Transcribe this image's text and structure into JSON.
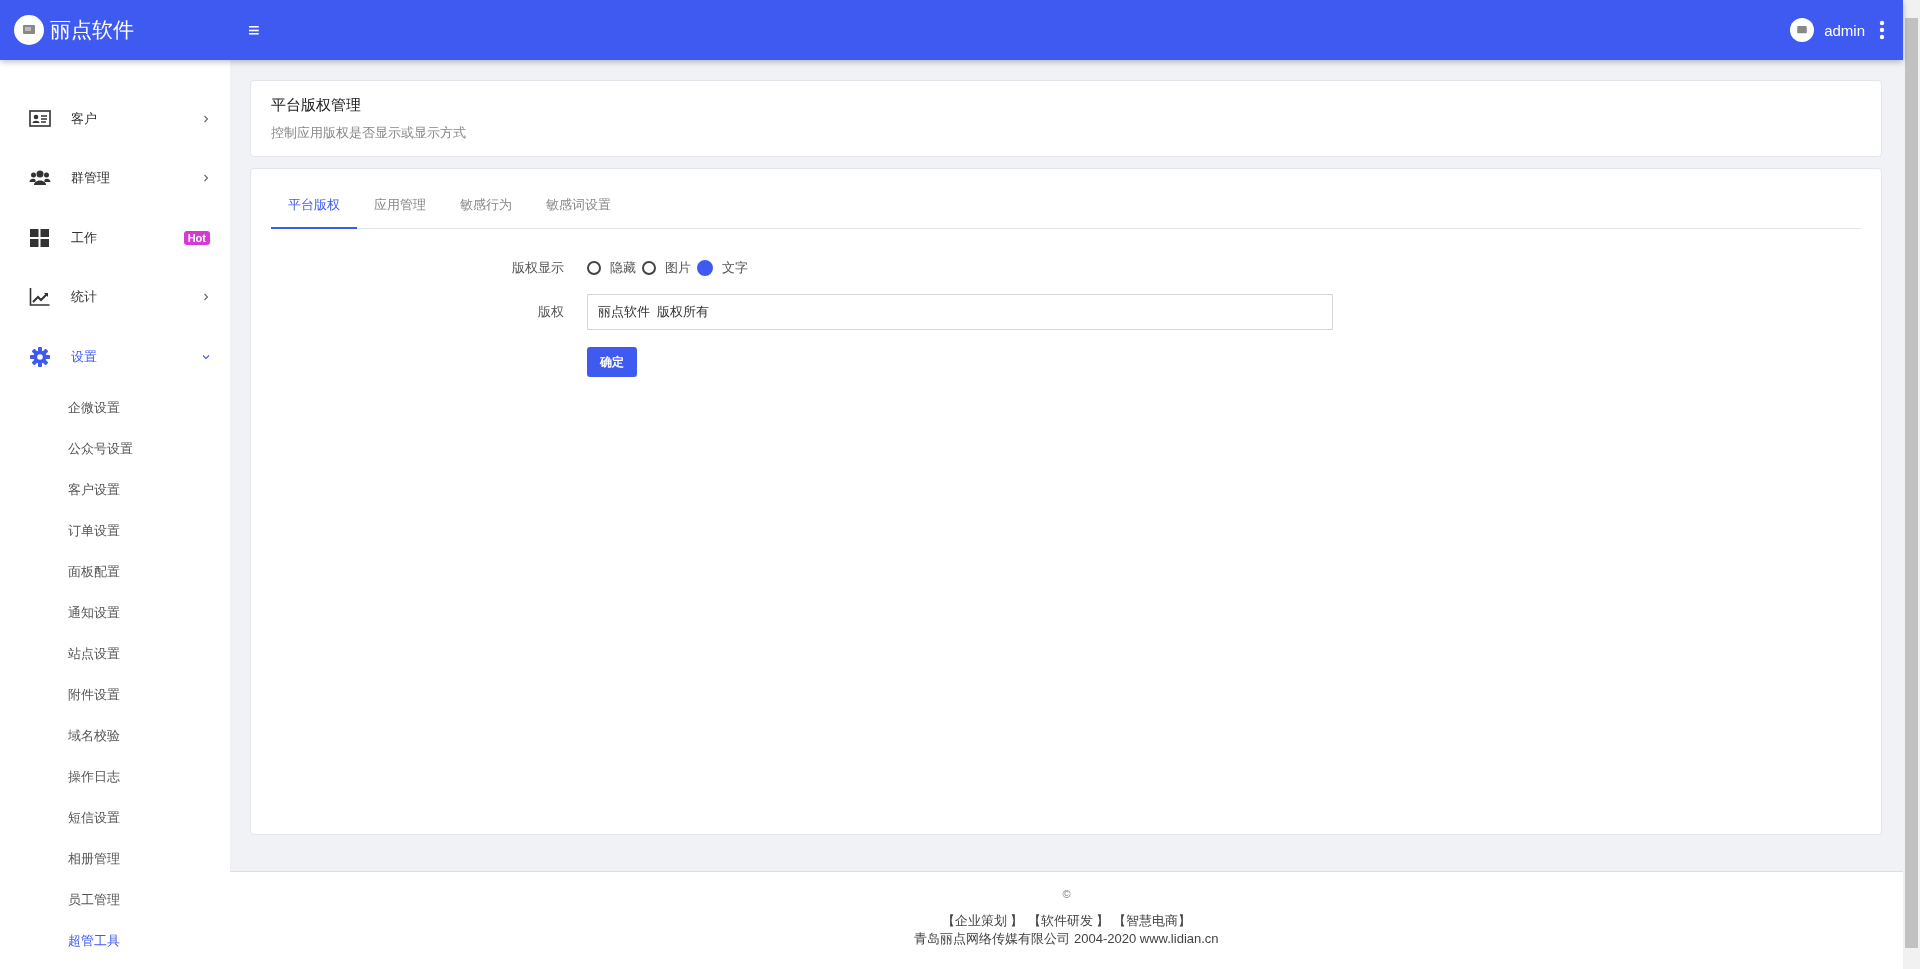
{
  "header": {
    "brand": "丽点软件",
    "menu_glyph": "≡",
    "user": "admin"
  },
  "sidebar": {
    "items": [
      {
        "label": "客户",
        "expanded": false,
        "selected": false
      },
      {
        "label": "群管理",
        "expanded": false,
        "selected": false
      },
      {
        "label": "工作",
        "badge": "Hot",
        "selected": false
      },
      {
        "label": "统计",
        "expanded": false,
        "selected": false
      },
      {
        "label": "设置",
        "expanded": true,
        "selected": true,
        "children": [
          {
            "label": "企微设置",
            "selected": false
          },
          {
            "label": "公众号设置",
            "selected": false
          },
          {
            "label": "客户设置",
            "selected": false
          },
          {
            "label": "订单设置",
            "selected": false
          },
          {
            "label": "面板配置",
            "selected": false
          },
          {
            "label": "通知设置",
            "selected": false
          },
          {
            "label": "站点设置",
            "selected": false
          },
          {
            "label": "附件设置",
            "selected": false
          },
          {
            "label": "域名校验",
            "selected": false
          },
          {
            "label": "操作日志",
            "selected": false
          },
          {
            "label": "短信设置",
            "selected": false
          },
          {
            "label": "相册管理",
            "selected": false
          },
          {
            "label": "员工管理",
            "selected": false
          },
          {
            "label": "超管工具",
            "selected": true
          }
        ]
      }
    ]
  },
  "page_header": {
    "title": "平台版权管理",
    "subtitle": "控制应用版权是否显示或显示方式"
  },
  "tabs": [
    {
      "label": "平台版权",
      "selected": true
    },
    {
      "label": "应用管理",
      "selected": false
    },
    {
      "label": "敏感行为",
      "selected": false
    },
    {
      "label": "敏感词设置",
      "selected": false
    }
  ],
  "form": {
    "display_label": "版权显示",
    "display_options": [
      {
        "label": "隐藏",
        "selected": false
      },
      {
        "label": "图片",
        "selected": false
      },
      {
        "label": "文字",
        "selected": true
      }
    ],
    "copyright_label": "版权",
    "copyright_value": "丽点软件  版权所有",
    "submit": "确定"
  },
  "footer": {
    "copyright_mark": "©",
    "links": [
      "【企业策划 】",
      "【软件研发 】",
      "【智慧电商】"
    ],
    "company": "青岛丽点网络传媒有限公司 2004-2020 www.lidian.cn"
  }
}
